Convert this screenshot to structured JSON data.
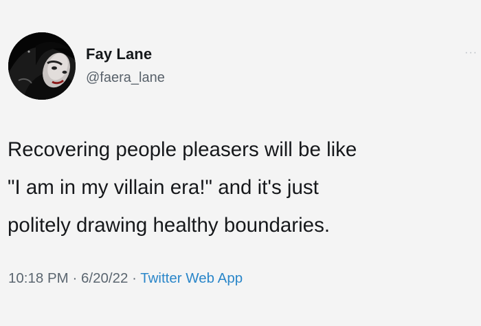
{
  "user": {
    "name": "Fay Lane",
    "handle": "@faera_lane"
  },
  "menu": {
    "icon": "more-dots-icon",
    "glyph": "···"
  },
  "tweet": {
    "lines": [
      "Recovering people pleasers will be like",
      "\"I am in my villain era!\" and it's just",
      "politely drawing healthy boundaries."
    ]
  },
  "meta": {
    "time": "10:18 PM",
    "separator": " · ",
    "date": "6/20/22",
    "source": "Twitter Web App"
  },
  "colors": {
    "background": "#f4f4f4",
    "text": "#16181b",
    "secondary": "#5b6670",
    "link": "#2a86c9"
  }
}
